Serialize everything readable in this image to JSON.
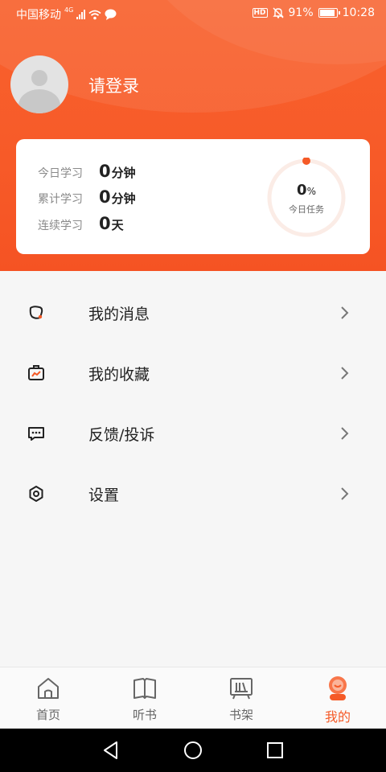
{
  "status_bar": {
    "carrier": "中国移动",
    "network": "4G",
    "battery_percent": "91%",
    "time": "10:28",
    "hd_label": "HD"
  },
  "profile": {
    "login_text": "请登录"
  },
  "stats": {
    "today_label": "今日学习",
    "today_value": "0",
    "today_unit": "分钟",
    "total_label": "累计学习",
    "total_value": "0",
    "total_unit": "分钟",
    "streak_label": "连续学习",
    "streak_value": "0",
    "streak_unit": "天",
    "task_percent": "0",
    "task_percent_sign": "%",
    "task_label": "今日任务",
    "task_progress": 0
  },
  "menu": [
    {
      "label": "我的消息",
      "icon": "message-icon"
    },
    {
      "label": "我的收藏",
      "icon": "favorites-icon"
    },
    {
      "label": "反馈/投诉",
      "icon": "feedback-icon"
    },
    {
      "label": "设置",
      "icon": "settings-icon"
    }
  ],
  "tabs": [
    {
      "label": "首页",
      "icon": "home-icon",
      "active": false
    },
    {
      "label": "听书",
      "icon": "book-icon",
      "active": false
    },
    {
      "label": "书架",
      "icon": "bookshelf-icon",
      "active": false
    },
    {
      "label": "我的",
      "icon": "profile-icon",
      "active": true
    }
  ],
  "colors": {
    "accent": "#f55a27",
    "header": "#f75a28"
  }
}
